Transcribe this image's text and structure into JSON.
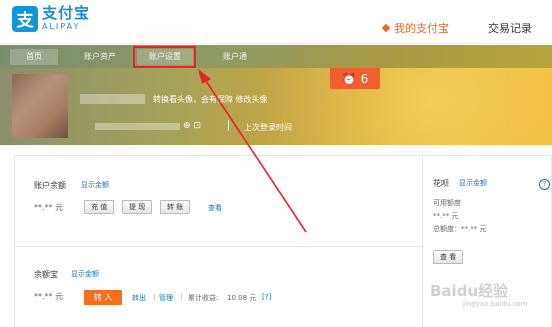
{
  "header": {
    "logo_symbol": "支",
    "logo_cn": "支付宝",
    "logo_en": "ALIPAY",
    "nav_active": "我的支付宝",
    "nav_2": "交易记录"
  },
  "subnav": {
    "items": [
      "首页",
      "账户资产",
      "账户设置",
      "账户通"
    ]
  },
  "banner": {
    "avatar_text": "转换看头像，会",
    "avatar_text2": "有保障 修改头像",
    "last_login": "上次登录时间",
    "security_icons": "⊕⊡",
    "badge_icon": "⏰",
    "badge_count": "6"
  },
  "balance": {
    "label": "账户余额",
    "show_amount": "显示金额",
    "amount": "**.** 元",
    "recharge": "充 值",
    "withdraw": "提 现",
    "transfer": "转 账",
    "view": "查看"
  },
  "yuebao": {
    "label": "余额宝",
    "show_amount": "显示金额",
    "amount": "**.** 元",
    "transfer_in": "转 入",
    "transfer_out": "转出",
    "manage": "管理",
    "income_label": "累计收益:",
    "income_value": "10.08 元",
    "income_help": "[?]"
  },
  "huabei": {
    "label": "花呗",
    "show_amount": "显示金额",
    "help": "?",
    "available_label": "可用额度",
    "available_value": "**.** 元",
    "total_label": "总额度：**.** 元",
    "view": "查 看"
  },
  "watermark": {
    "main": "Baidu经验",
    "sub": "jingyan.baidu.com"
  },
  "colors": {
    "brand_blue": "#1296db",
    "accent_orange": "#f26522",
    "highlight_red": "#e8242b",
    "link_blue": "#1a6fc4"
  }
}
